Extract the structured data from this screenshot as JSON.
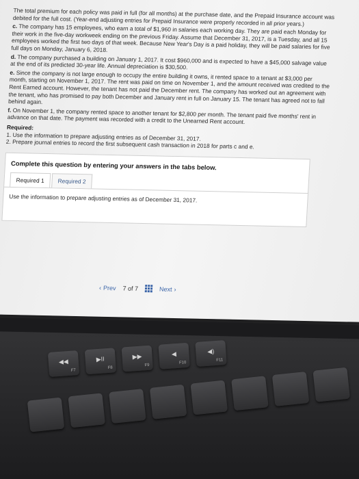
{
  "problem": {
    "intro": "The total premium for each policy was paid in full (for all months) at the purchase date, and the Prepaid Insurance account was debited for the full cost. (Year-end adjusting entries for Prepaid Insurance were properly recorded in all prior years.)",
    "c_label": "c.",
    "c_text": "The company has 15 employees, who earn a total of $1,960 in salaries each working day. They are paid each Monday for their work in the five-day workweek ending on the previous Friday. Assume that December 31, 2017, is a Tuesday, and all 15 employees worked the first two days of that week. Because New Year's Day is a paid holiday, they will be paid salaries for five full days on Monday, January 6, 2018.",
    "d_label": "d.",
    "d_text": "The company purchased a building on January 1, 2017. It cost $960,000 and is expected to have a $45,000 salvage value at the end of its predicted 30-year life. Annual depreciation is $30,500.",
    "e_label": "e.",
    "e_text": "Since the company is not large enough to occupy the entire building it owns, it rented space to a tenant at $3,000 per month, starting on November 1, 2017. The rent was paid on time on November 1, and the amount received was credited to the Rent Earned account. However, the tenant has not paid the December rent. The company has worked out an agreement with the tenant, who has promised to pay both December and January rent in full on January 15. The tenant has agreed not to fall behind again.",
    "f_label": "f.",
    "f_text": "On November 1, the company rented space to another tenant for $2,800 per month. The tenant paid five months' rent in advance on that date. The payment was recorded with a credit to the Unearned Rent account."
  },
  "required": {
    "title": "Required:",
    "item1": "1. Use the information to prepare adjusting entries as of December 31, 2017.",
    "item2": "2. Prepare journal entries to record the first subsequent cash transaction in 2018 for parts c and e."
  },
  "instructions": {
    "title": "Complete this question by entering your answers in the tabs below.",
    "tabs": [
      "Required 1",
      "Required 2"
    ],
    "body": "Use the information to prepare adjusting entries as of December 31, 2017."
  },
  "pager": {
    "prev": "Prev",
    "position": "7",
    "of": "of 7",
    "next": "Next"
  },
  "keyboard": {
    "keys": [
      {
        "glyph": "◀◀",
        "fn": "F7"
      },
      {
        "glyph": "▶II",
        "fn": "F8"
      },
      {
        "glyph": "▶▶",
        "fn": "F9"
      },
      {
        "glyph": "◀",
        "fn": "F10"
      },
      {
        "glyph": "◀)",
        "fn": "F11"
      }
    ]
  }
}
